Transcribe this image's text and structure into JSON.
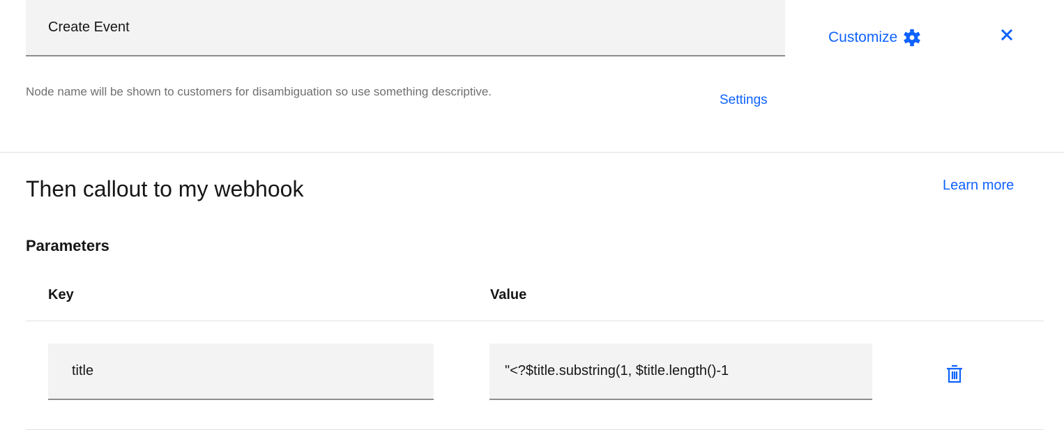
{
  "node": {
    "name_value": "Create Event",
    "helper_text": "Node name will be shown to customers for disambiguation so use something descriptive."
  },
  "header": {
    "customize_label": "Customize",
    "settings_label": "Settings"
  },
  "section": {
    "title": "Then callout to my webhook",
    "learn_more_label": "Learn more"
  },
  "parameters": {
    "heading": "Parameters",
    "columns": [
      "Key",
      "Value"
    ],
    "rows": [
      {
        "key": "title",
        "value": "\"<?$title.substring(1, $title.length()-1"
      }
    ]
  },
  "colors": {
    "link": "#0f62fe",
    "field_bg": "#f3f3f3",
    "helper": "#6f6f6f"
  },
  "icons": [
    "gear-icon",
    "close-icon",
    "trash-icon"
  ]
}
